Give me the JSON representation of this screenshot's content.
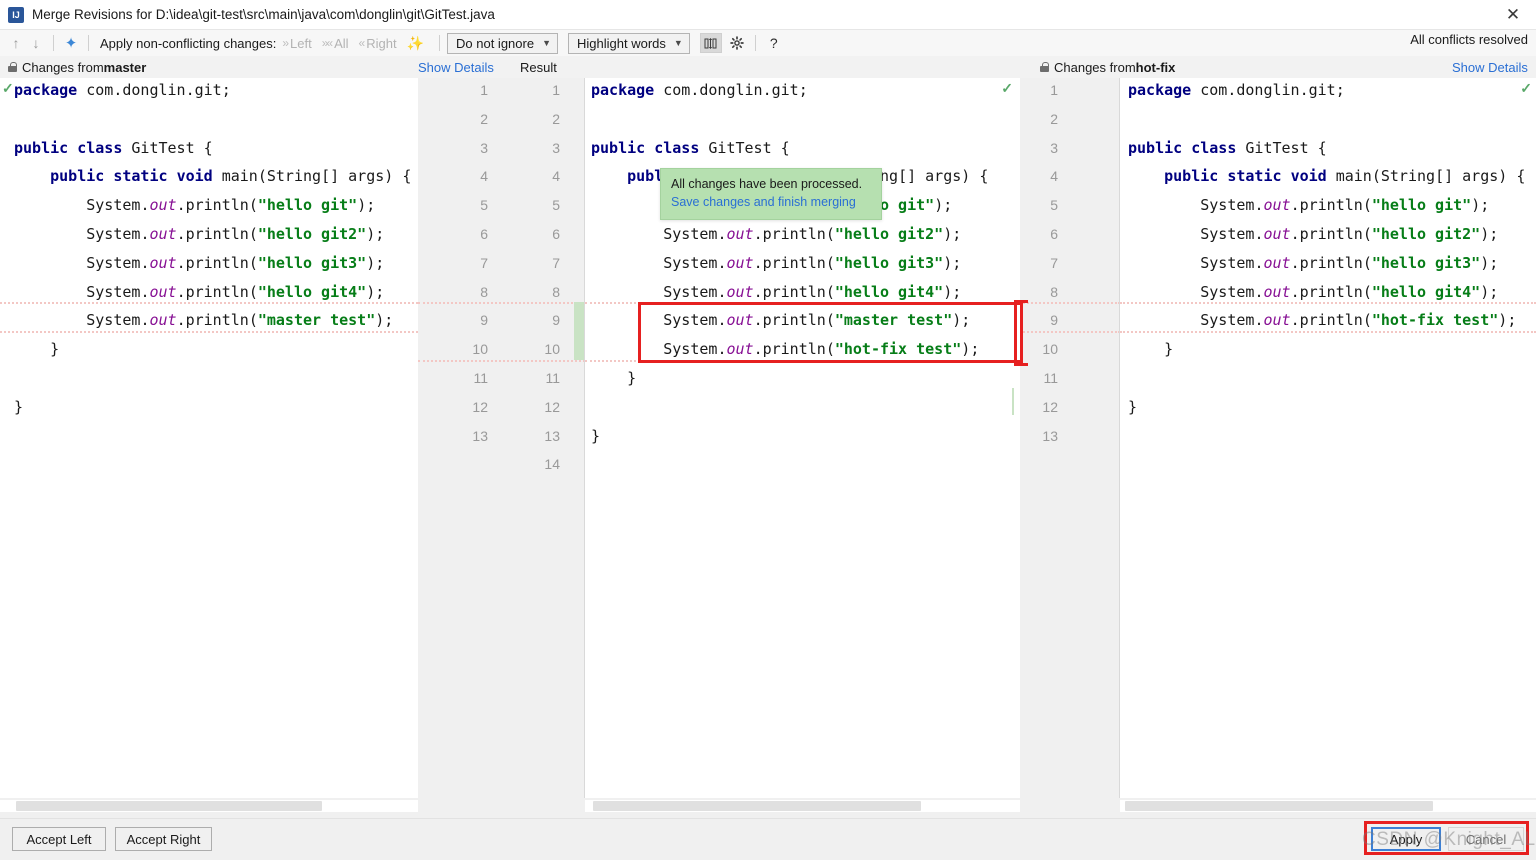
{
  "window": {
    "title": "Merge Revisions for D:\\idea\\git-test\\src\\main\\java\\com\\donglin\\git\\GitTest.java",
    "app_icon": "intellij-idea-icon",
    "close_label": "✕"
  },
  "toolbar": {
    "prev_icon": "arrow-up-icon",
    "next_icon": "arrow-down-icon",
    "apply_all_icon": "apply-non-conflicting-icon",
    "apply_label": "Apply non-conflicting changes:",
    "left_label": "Left",
    "all_label": "All",
    "right_label": "Right",
    "magic_icon": "magic-wand-icon",
    "ignore_combo": "Do not ignore",
    "highlight_combo": "Highlight words",
    "collapse_icon": "collapse-unchanged-icon",
    "settings_icon": "gear-icon",
    "help_icon": "help-icon",
    "conflicts_status": "All conflicts resolved",
    "caret": "⌄"
  },
  "panels": {
    "left": {
      "lock_icon": "lock-icon",
      "header_prefix": "Changes from ",
      "header_branch": "master",
      "show_details": "Show Details"
    },
    "center": {
      "result_label": "Result"
    },
    "right": {
      "lock_icon": "lock-icon",
      "header_prefix": "Changes from ",
      "header_branch": "hot-fix",
      "show_details": "Show Details"
    }
  },
  "tooltip": {
    "line1": "All changes have been processed.",
    "line2": "Save changes and finish merging"
  },
  "gutters": {
    "left_numbers": [
      "1",
      "2",
      "3",
      "4",
      "5",
      "6",
      "7",
      "8",
      "9",
      "10",
      "11",
      "12",
      "13"
    ],
    "right_numbers": [
      "1",
      "2",
      "3",
      "4",
      "5",
      "6",
      "7",
      "8",
      "9",
      "10",
      "11",
      "12",
      "13",
      "14"
    ],
    "far_right_numbers": [
      "1",
      "2",
      "3",
      "4",
      "5",
      "6",
      "7",
      "8",
      "9",
      "10",
      "11",
      "12",
      "13"
    ]
  },
  "code": {
    "left": [
      "package com.donglin.git;",
      "",
      "public class GitTest {",
      "    public static void main(String[] args) {",
      "        System.out.println(\"hello git\");",
      "        System.out.println(\"hello git2\");",
      "        System.out.println(\"hello git3\");",
      "        System.out.println(\"hello git4\");",
      "        System.out.println(\"master test\");",
      "    }",
      "",
      "}",
      ""
    ],
    "center": [
      "package com.donglin.git;",
      "",
      "public class GitTest {",
      "    public static void main(String[] args) {",
      "        System.out.println(\"hello git\");",
      "        System.out.println(\"hello git2\");",
      "        System.out.println(\"hello git3\");",
      "        System.out.println(\"hello git4\");",
      "        System.out.println(\"master test\");",
      "        System.out.println(\"hot-fix test\");",
      "    }",
      "",
      "}",
      ""
    ],
    "right": [
      "package com.donglin.git;",
      "",
      "public class GitTest {",
      "    public static void main(String[] args) {",
      "        System.out.println(\"hello git\");",
      "        System.out.println(\"hello git2\");",
      "        System.out.println(\"hello git3\");",
      "        System.out.println(\"hello git4\");",
      "        System.out.println(\"hot-fix test\");",
      "    }",
      "",
      "}",
      ""
    ]
  },
  "bottom": {
    "accept_left": "Accept Left",
    "accept_right": "Accept Right",
    "apply": "Apply",
    "cancel": "Cancel"
  },
  "watermark": {
    "text": "CSDN @Knight_AL"
  },
  "colors": {
    "accent_blue": "#2a6fd4",
    "conflict_red": "#e62020",
    "change_green": "#c9e3c4",
    "keyword_blue": "#000080",
    "string_green": "#067d17",
    "field_purple": "#871094",
    "tooltip_green": "#b6e0b0"
  }
}
